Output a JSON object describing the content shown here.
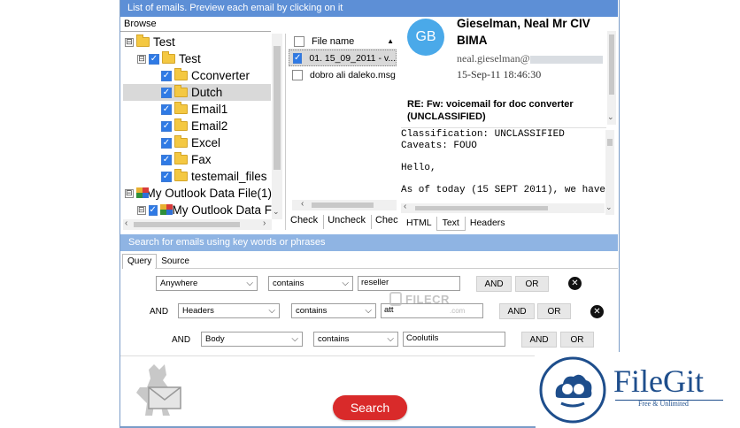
{
  "window": {
    "title_bar": "List of emails. Preview each email by clicking on it"
  },
  "browse_tab": "Browse",
  "tree": [
    {
      "label": "Test",
      "expander": "⊟",
      "checked": false,
      "icon": "folder-icon"
    },
    {
      "label": "Test",
      "expander": "⊟",
      "checked": true,
      "icon": "folder-icon"
    },
    {
      "label": "Cconverter",
      "checked": true,
      "icon": "folder-icon"
    },
    {
      "label": "Dutch",
      "checked": true,
      "icon": "folder-icon",
      "selected": true
    },
    {
      "label": "Email1",
      "checked": true,
      "icon": "folder-icon"
    },
    {
      "label": "Email2",
      "checked": true,
      "icon": "folder-icon"
    },
    {
      "label": "Excel",
      "checked": true,
      "icon": "folder-icon"
    },
    {
      "label": "Fax",
      "checked": true,
      "icon": "folder-icon"
    },
    {
      "label": "testemail_files",
      "checked": true,
      "icon": "folder-icon"
    },
    {
      "label": "My Outlook Data File(1)",
      "expander": "⊟",
      "icon": "pst-icon"
    },
    {
      "label": "My Outlook Data F",
      "expander": "⊟",
      "checked": true,
      "icon": "pst-icon"
    }
  ],
  "file_list": {
    "header": "File name",
    "rows": [
      {
        "name": "01. 15_09_2011 - v...",
        "checked": true,
        "selected": true
      },
      {
        "name": "dobro ali daleko.msg",
        "checked": false,
        "selected": false
      }
    ],
    "buttons": [
      "Check",
      "Uncheck",
      "Check"
    ]
  },
  "preview": {
    "avatar_initials": "GB",
    "sender_name": "Gieselman, Neal Mr CIV",
    "sender_org": "BIMA",
    "sender_email": "neal.gieselman@",
    "sent": "15-Sep-11 18:46:30",
    "subject": "RE: Fw: voicemail for doc converter (UNCLASSIFIED)",
    "body_lines": [
      "Classification: UNCLASSIFIED",
      "Caveats: FOUO",
      "",
      "Hello,",
      "",
      "As of today (15 SEPT 2011), we have"
    ],
    "tabs": [
      "HTML",
      "Text",
      "Headers"
    ],
    "active_tab": "Text"
  },
  "search": {
    "section_title": "Search for emails using key words or phrases",
    "tabs": [
      "Query",
      "Source"
    ],
    "rows": [
      {
        "connector": "",
        "field": "Anywhere",
        "operator": "contains",
        "value": "reseller",
        "and_label": "AND",
        "or_label": "OR",
        "has_remove": true
      },
      {
        "connector": "AND",
        "field": "Headers",
        "operator": "contains",
        "value": "att",
        "and_label": "AND",
        "or_label": "OR",
        "has_remove": true
      },
      {
        "connector": "AND",
        "field": "Body",
        "operator": "contains",
        "value": "Coolutils",
        "and_label": "AND",
        "or_label": "OR",
        "has_remove": false
      }
    ],
    "search_button": "Search"
  },
  "watermarks": {
    "filecr": "FILECR",
    "filecr_sub": ".com",
    "filegit": "FileGit",
    "filegit_sub": "Free & Unlimited"
  },
  "colors": {
    "title_bar": "#5d8fd6",
    "search_bar": "#8fb4e3",
    "avatar": "#4aa9e9",
    "search_button": "#d92a2a",
    "checkbox": "#2f7ae5",
    "selected_row": "#d9d9d9",
    "filegit_blue": "#1e4e8c"
  }
}
